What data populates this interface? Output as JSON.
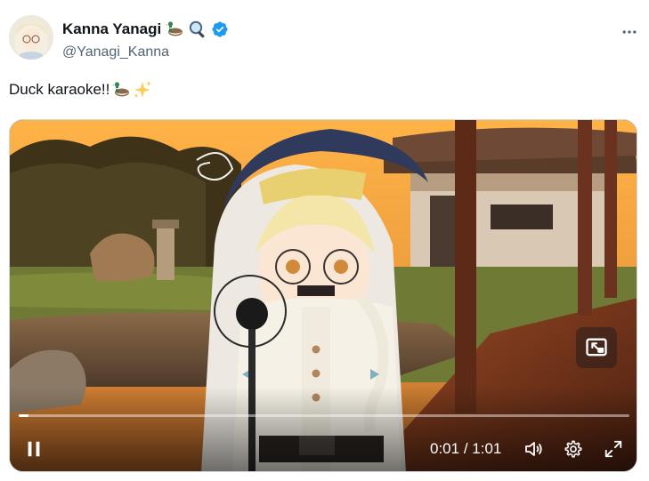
{
  "author": {
    "display_name": "Kanna Yanagi",
    "handle": "@Yanagi_Kanna",
    "name_emojis": [
      "duck-emoji",
      "magnifier-emoji"
    ],
    "verified": true
  },
  "tweet": {
    "text": "Duck karaoke!!",
    "text_emojis": [
      "duck-emoji",
      "sparkles-emoji"
    ]
  },
  "video": {
    "current_time": "0:01",
    "separator": "/",
    "duration": "1:01",
    "progress_fraction": 0.016,
    "state": "playing"
  },
  "icons": {
    "more": "more-horizontal-icon",
    "pause": "pause-icon",
    "volume": "volume-icon",
    "settings": "gear-icon",
    "fullscreen": "fullscreen-icon",
    "pip": "picture-in-picture-icon",
    "verified": "verified-badge-icon"
  },
  "colors": {
    "verified_blue": "#1d9bf0",
    "text_primary": "#0f1419",
    "text_secondary": "#536471"
  }
}
